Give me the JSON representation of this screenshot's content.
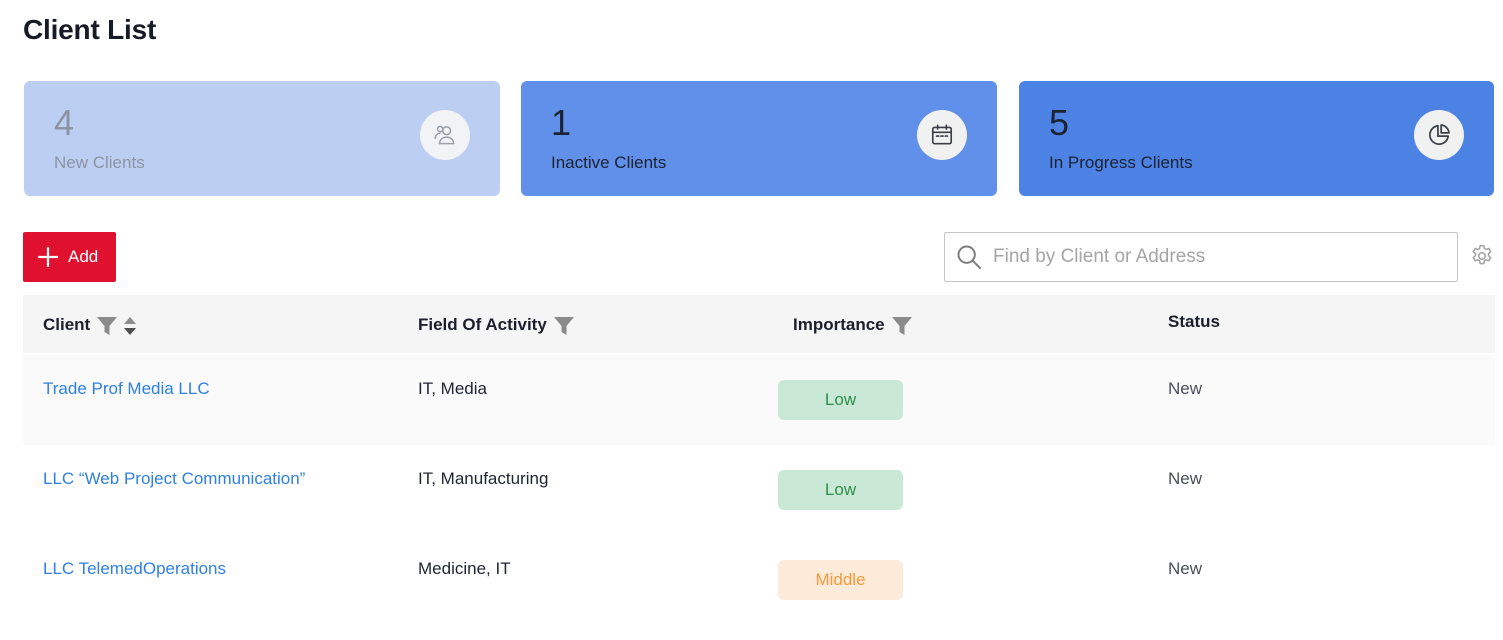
{
  "page": {
    "title": "Client List"
  },
  "cards": [
    {
      "count": "4",
      "label": "New Clients",
      "icon": "users-icon"
    },
    {
      "count": "1",
      "label": "Inactive Clients",
      "icon": "calendar-icon"
    },
    {
      "count": "5",
      "label": "In Progress Clients",
      "icon": "pie-chart-icon"
    }
  ],
  "toolbar": {
    "add_label": "Add",
    "search_placeholder": "Find by Client or Address",
    "search_value": ""
  },
  "table": {
    "columns": [
      "Client",
      "Field Of Activity",
      "Importance",
      "Status"
    ],
    "rows": [
      {
        "client": "Trade Prof Media LLC",
        "field": "IT, Media",
        "importance": "Low",
        "status": "New"
      },
      {
        "client": "LLC “Web Project Communication”",
        "field": "IT, Manufacturing",
        "importance": "Low",
        "status": "New"
      },
      {
        "client": "LLC TelemedOperations",
        "field": "Medicine, IT",
        "importance": "Middle",
        "status": "New"
      }
    ]
  },
  "colors": {
    "accent_red": "#e0112f",
    "link_blue": "#2f80e4",
    "card_light": "#bccff3",
    "card_mid": "#6090e9",
    "card_dark": "#4d82e5",
    "badge_low_bg": "#c9e9d6",
    "badge_middle_bg": "#fdebd9"
  }
}
